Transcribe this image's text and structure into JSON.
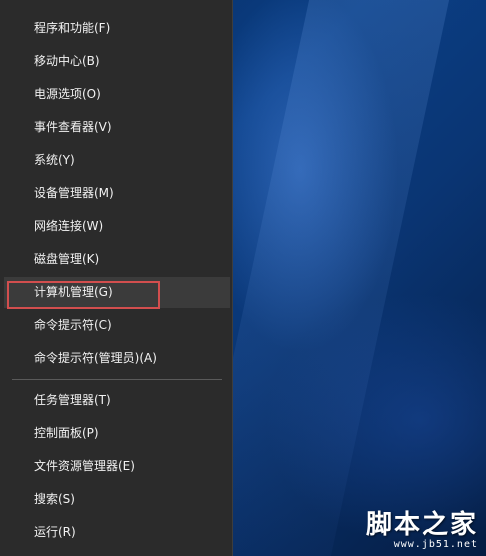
{
  "menu": {
    "group1": [
      {
        "label": "程序和功能(F)"
      },
      {
        "label": "移动中心(B)"
      },
      {
        "label": "电源选项(O)"
      },
      {
        "label": "事件查看器(V)"
      },
      {
        "label": "系统(Y)"
      },
      {
        "label": "设备管理器(M)"
      },
      {
        "label": "网络连接(W)"
      },
      {
        "label": "磁盘管理(K)"
      },
      {
        "label": "计算机管理(G)"
      },
      {
        "label": "命令提示符(C)"
      },
      {
        "label": "命令提示符(管理员)(A)"
      }
    ],
    "group2": [
      {
        "label": "任务管理器(T)"
      },
      {
        "label": "控制面板(P)"
      },
      {
        "label": "文件资源管理器(E)"
      },
      {
        "label": "搜索(S)"
      },
      {
        "label": "运行(R)"
      }
    ],
    "highlighted": "计算机管理(G)"
  },
  "watermark": {
    "title": "脚本之家",
    "url": "www.jb51.net"
  },
  "colors": {
    "menu_bg": "#2b2b2b",
    "hover_bg": "#3b3b3b",
    "highlight_border": "#d24e4e",
    "text": "#f2f2f2"
  }
}
